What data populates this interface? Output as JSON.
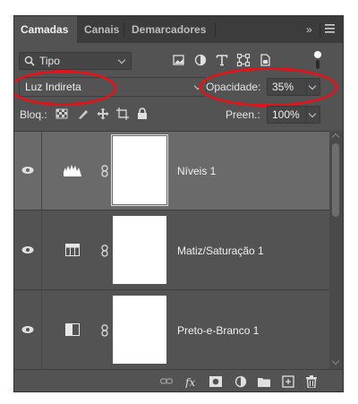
{
  "tabs": [
    {
      "label": "Camadas",
      "active": true
    },
    {
      "label": "Canais",
      "active": false
    },
    {
      "label": "Demarcadores",
      "active": false
    }
  ],
  "tab_right": {
    "expand_label": "»",
    "menu_icon": "hamburger-menu-icon"
  },
  "filter": {
    "kind_value": "Tipo",
    "icons": [
      "pixel-filter-icon",
      "adjustment-filter-icon",
      "type-filter-icon",
      "shape-filter-icon",
      "smart-object-filter-icon",
      "filter-toggle-icon"
    ]
  },
  "blend": {
    "mode_value": "Luz Indireta"
  },
  "opacity": {
    "label": "Opacidade:",
    "value": "35%"
  },
  "lock": {
    "label": "Bloq.:",
    "icons": [
      "lock-transparent-icon",
      "lock-image-icon",
      "lock-position-icon",
      "artboard-icon",
      "lock-all-icon"
    ]
  },
  "fill": {
    "label": "Preen.:",
    "value": "100%"
  },
  "layers": [
    {
      "name": "Níveis 1",
      "type": "levels",
      "visible": true,
      "selected": true
    },
    {
      "name": "Matiz/Saturação 1",
      "type": "hue-saturation",
      "visible": true,
      "selected": false
    },
    {
      "name": "Preto-e-Branco 1",
      "type": "black-white",
      "visible": true,
      "selected": false
    }
  ],
  "footer_icons": [
    "link-layers-icon",
    "fx-icon",
    "add-mask-icon",
    "new-adjustment-icon",
    "new-group-icon",
    "new-layer-icon",
    "delete-icon"
  ],
  "colors": {
    "panel": "#535353",
    "selected_row": "#6a6a6a",
    "highlight": "#e0141b"
  }
}
